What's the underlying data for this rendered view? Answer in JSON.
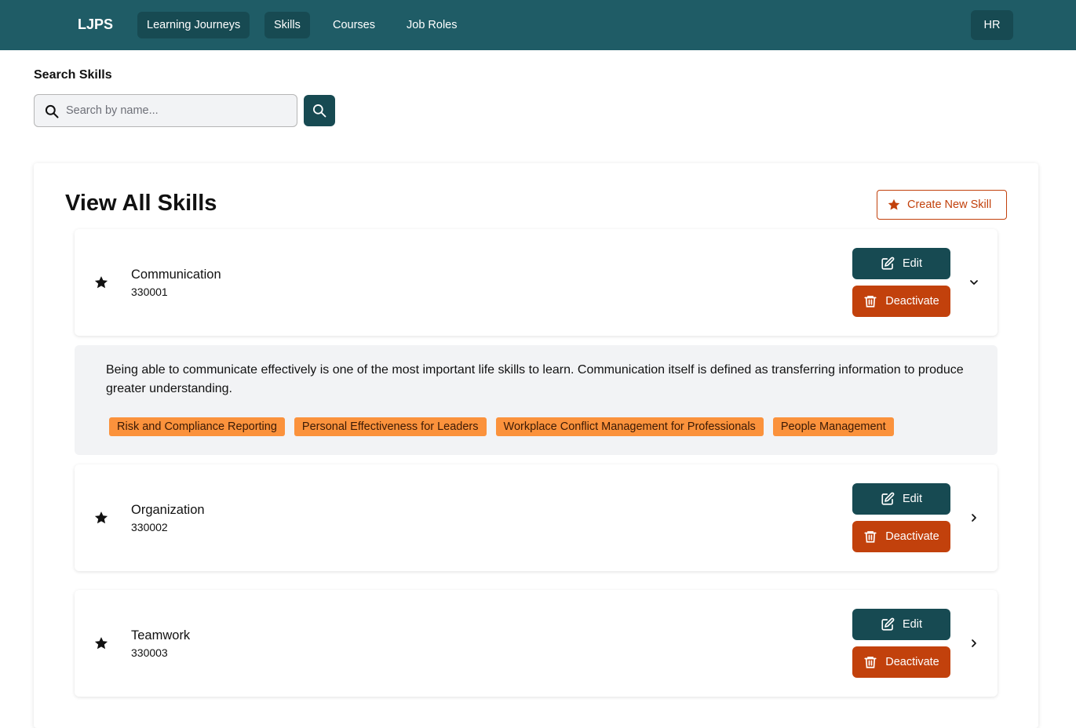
{
  "nav": {
    "brand": "LJPS",
    "items": [
      {
        "label": "Learning Journeys",
        "active": true
      },
      {
        "label": "Skills",
        "active": true
      },
      {
        "label": "Courses",
        "active": false
      },
      {
        "label": "Job Roles",
        "active": false
      }
    ],
    "user_badge": "HR"
  },
  "search": {
    "label": "Search Skills",
    "placeholder": "Search by name...",
    "value": ""
  },
  "main": {
    "title": "View All Skills",
    "create_label": "Create New Skill"
  },
  "skills": [
    {
      "name": "Communication",
      "id": "330001",
      "expanded": true,
      "edit_label": "Edit",
      "deactivate_label": "Deactivate",
      "description": "Being able to communicate effectively is one of the most important life skills to learn. Communication itself is defined as transferring information to produce greater understanding.",
      "courses": [
        "Risk and Compliance Reporting",
        "Personal Effectiveness for Leaders",
        "Workplace Conflict Management for Professionals",
        "People Management"
      ]
    },
    {
      "name": "Organization",
      "id": "330002",
      "expanded": false,
      "edit_label": "Edit",
      "deactivate_label": "Deactivate"
    },
    {
      "name": "Teamwork",
      "id": "330003",
      "expanded": false,
      "edit_label": "Edit",
      "deactivate_label": "Deactivate"
    }
  ],
  "colors": {
    "header_bg": "#1f5c66",
    "primary": "#174a52",
    "danger": "#c2410c",
    "tag": "#fb923c"
  }
}
